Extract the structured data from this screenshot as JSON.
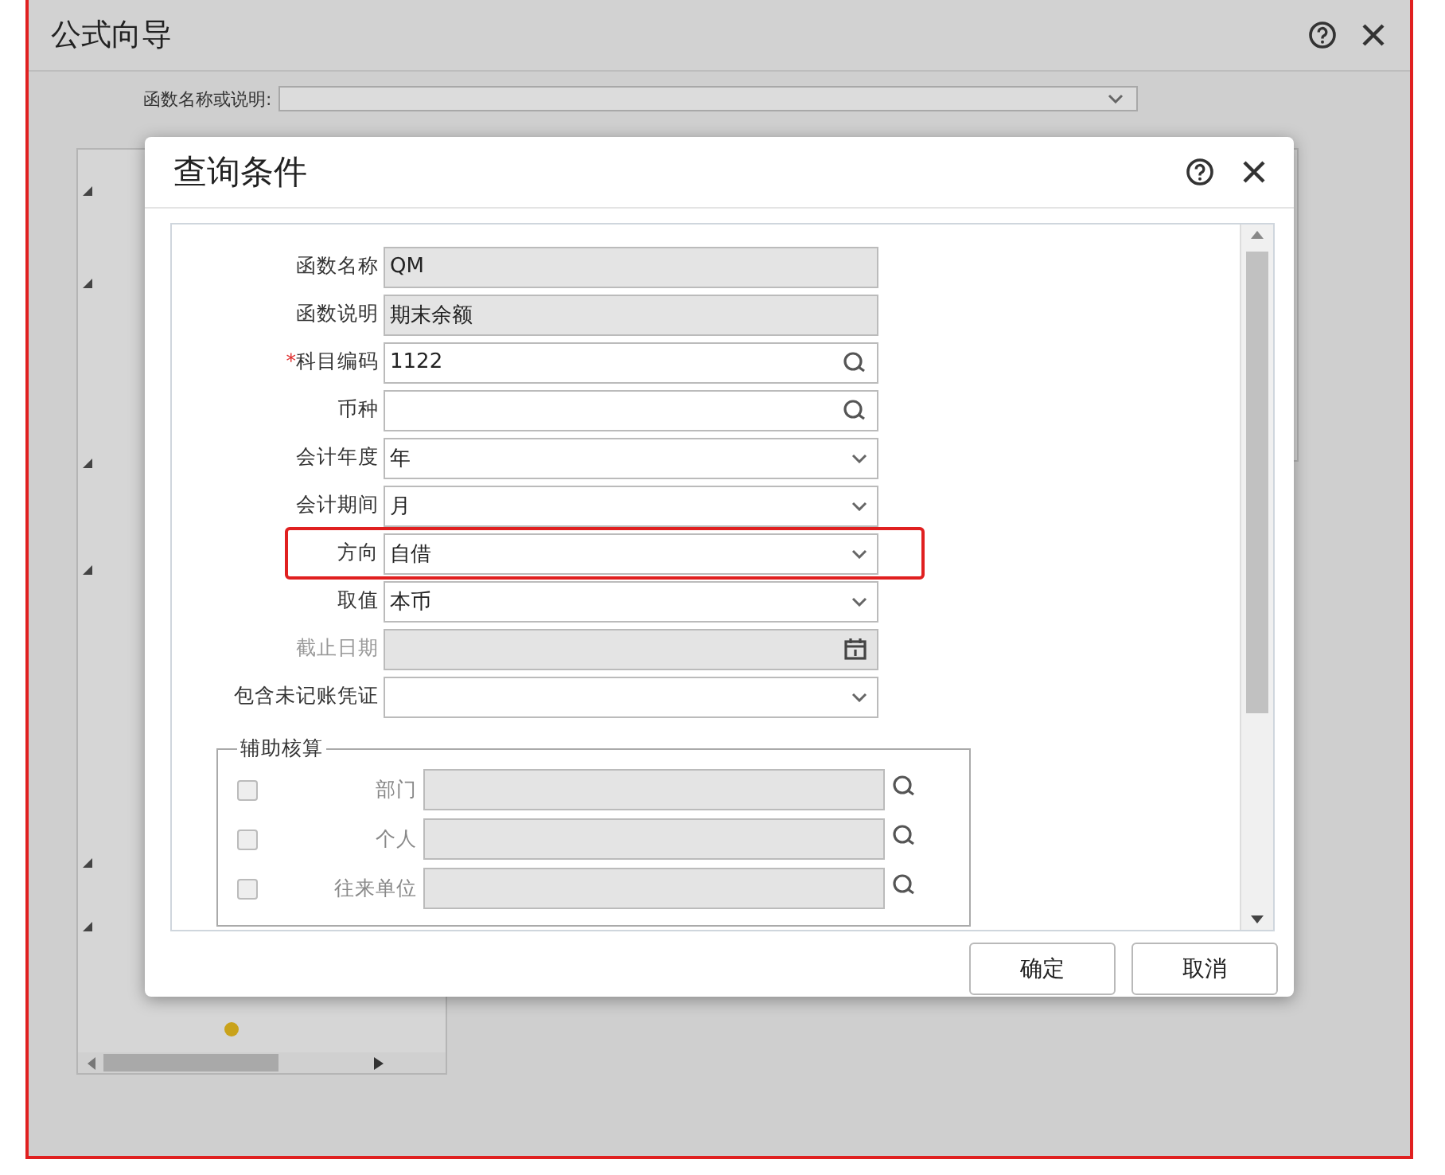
{
  "window": {
    "title": "公式向导"
  },
  "function_search": {
    "label": "函数名称或说明:"
  },
  "tree": {
    "items": [
      {
        "expanded": true
      },
      {
        "expanded": true
      },
      {
        "expanded": true
      },
      {
        "expanded": true
      },
      {
        "expanded": true
      },
      {
        "expanded": true
      }
    ]
  },
  "dialog": {
    "title": "查询条件",
    "fields": [
      {
        "label": "函数名称",
        "value": "QM",
        "kind": "readonly",
        "disabled": false,
        "highlighted": false
      },
      {
        "label": "函数说明",
        "value": "期末余额",
        "kind": "readonly",
        "disabled": false,
        "highlighted": false
      },
      {
        "label": "科目编码",
        "required_mark": "*",
        "value": "1122",
        "kind": "lookup",
        "disabled": false,
        "highlighted": false
      },
      {
        "label": "币种",
        "kind": "lookup",
        "disabled": false,
        "highlighted": false
      },
      {
        "label": "会计年度",
        "value": "年",
        "kind": "select",
        "disabled": false,
        "highlighted": false
      },
      {
        "label": "会计期间",
        "value": "月",
        "kind": "select",
        "disabled": false,
        "highlighted": false
      },
      {
        "label": "方向",
        "value": "自借",
        "kind": "select",
        "disabled": false,
        "highlighted": true
      },
      {
        "label": "取值",
        "value": "本币",
        "kind": "select",
        "disabled": false,
        "highlighted": false
      },
      {
        "label": "截止日期",
        "kind": "date",
        "disabled": true,
        "highlighted": false
      },
      {
        "label": "包含未记账凭证",
        "kind": "select",
        "disabled": false,
        "highlighted": false
      }
    ],
    "aux_group": {
      "title": "辅助核算",
      "items": [
        {
          "label": "部门",
          "checked": false,
          "disabled": true
        },
        {
          "label": "个人",
          "checked": false,
          "disabled": true
        },
        {
          "label": "往来单位",
          "checked": false,
          "disabled": true
        }
      ]
    },
    "buttons": [
      "确定",
      "取消"
    ]
  }
}
